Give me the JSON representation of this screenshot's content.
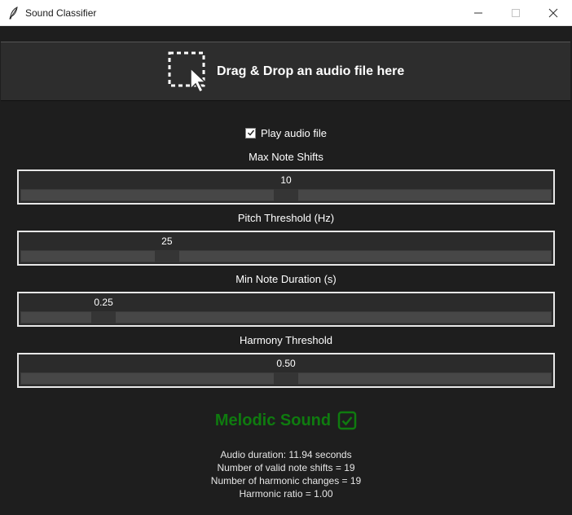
{
  "window": {
    "title": "Sound Classifier",
    "icon": "feather-icon"
  },
  "dropzone": {
    "label": "Drag & Drop an audio file here",
    "icon": "drop-target-cursor-icon"
  },
  "play_audio": {
    "label": "Play audio file",
    "checked": true
  },
  "sliders": [
    {
      "label": "Max Note Shifts",
      "value": "10",
      "fraction": 0.5
    },
    {
      "label": "Pitch Threshold (Hz)",
      "value": "25",
      "fraction": 0.265
    },
    {
      "label": "Min Note Duration (s)",
      "value": "0.25",
      "fraction": 0.14
    },
    {
      "label": "Harmony Threshold",
      "value": "0.50",
      "fraction": 0.5
    }
  ],
  "result": {
    "label": "Melodic Sound",
    "color": "#0f7b0f",
    "icon": "checkbox-checked-icon"
  },
  "stats": {
    "duration": "Audio duration: 11.94 seconds",
    "note_shifts": "Number of valid note shifts = 19",
    "harmonic_changes": "Number of harmonic changes = 19",
    "harmonic_ratio": "Harmonic ratio = 1.00"
  }
}
